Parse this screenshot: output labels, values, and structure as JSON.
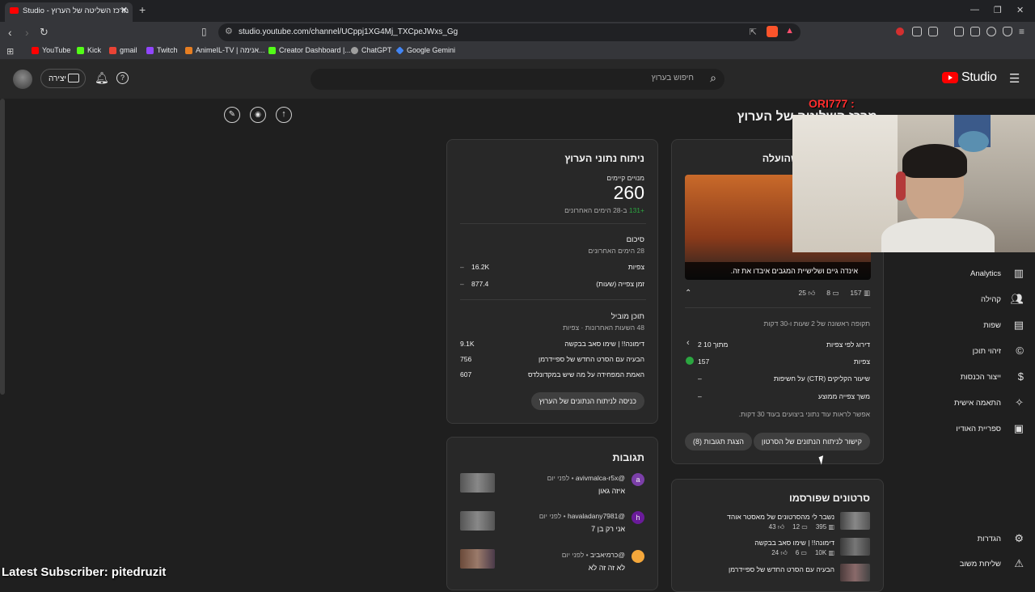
{
  "browser": {
    "tab_title": "מרכז השליטה של הערוץ - Studio",
    "url": "studio.youtube.com/channel/UCppj1XG4Mj_TXCpeJWxs_Gg",
    "bookmarks": [
      "YouTube",
      "Kick",
      "gmail",
      "Twitch",
      "AnimeIL-TV | אנימה...",
      "Creator Dashboard |...",
      "ChatGPT",
      "Google Gemini"
    ],
    "bookmark_colors": [
      "#ff0000",
      "#53fc18",
      "#ea4335",
      "#9146ff",
      "#e67e22",
      "#53fc18",
      "#9e9e9e",
      "#4285f4"
    ]
  },
  "header": {
    "logo_text": "Studio",
    "search_placeholder": "חיפוש בערוץ",
    "create_label": "יצירה"
  },
  "overlay": {
    "streamer_name": "ORI777 :",
    "latest_subscriber": "Latest Subscriber: pitedruzit"
  },
  "page": {
    "title": "מרכז השליטה של הערוץ"
  },
  "latest_video": {
    "heading": "הסרטון האחרון שהועלה",
    "video_title": "אינדה גיים ושלישיית המגבים איבדו את זה.",
    "views": "157",
    "comments": "8",
    "likes": "25",
    "first_period": "תקופה ראשונה של 2 שעות ו-30 דקות",
    "rank_label": "דירוג לפי צפיות",
    "rank_value": "2 מתוך 10",
    "views_label": "צפיות",
    "views_value": "157",
    "ctr_label": "שיעור הקליקים (CTR) על חשיפות",
    "ctr_value": "–",
    "avd_label": "משך צפייה ממוצע",
    "avd_value": "–",
    "note": "אפשר לראות עוד נתוני ביצועים בעוד 30 דקות.",
    "btn_analytics": "קישור לניתוח הנתונים של הסרטון",
    "btn_comments": "הצגת תגובות (8)"
  },
  "channel_analytics": {
    "heading": "ניתוח נתוני הערוץ",
    "subs_label": "מנויים קיימים",
    "subs_value": "260",
    "subs_change_num": "+131",
    "subs_change_text": "ב-28 הימים האחרונים",
    "summary_heading": "סיכום",
    "summary_sub": "28 הימים האחרונים",
    "summary_rows": [
      {
        "label": "צפיות",
        "value": "16.2K",
        "trend": "–"
      },
      {
        "label": "זמן צפייה (שעות)",
        "value": "877.4",
        "trend": "–"
      }
    ],
    "top_heading": "תוכן מוביל",
    "top_sub": "48 השעות האחרונות · צפיות",
    "top_rows": [
      {
        "label": "דימונה!! | שימו סאב בבקשה",
        "value": "9.1K"
      },
      {
        "label": "הבעיה עם הסרט החדש של ספיידרמן",
        "value": "756"
      },
      {
        "label": "האמת המפחידה על מה שיש במקדונלדס",
        "value": "607"
      }
    ],
    "btn": "כניסה לניתוח הנתונים של הערוץ"
  },
  "comments": {
    "heading": "תגובות",
    "items": [
      {
        "user": "@avivmalca-r5x",
        "time": "לפני יום",
        "text": "איזה גאון",
        "avatar_letter": "a",
        "avatar_color": "#7b3fa8"
      },
      {
        "user": "@havaladany7981",
        "time": "לפני יום",
        "text": "אני רק בן 7",
        "avatar_letter": "h",
        "avatar_color": "#6a1b9a"
      },
      {
        "user": "@כרמיאביב",
        "time": "לפני יום",
        "text": "לא זה זה לא",
        "avatar_letter": "",
        "avatar_color": "#f4a73b"
      }
    ]
  },
  "published_shorts": {
    "heading": "סרטונים שפורסמו",
    "items": [
      {
        "title": "נשבר לי מהסרטונים של מאסטר אוהד",
        "views": "395",
        "comments": "12",
        "likes": "43"
      },
      {
        "title": "דימונה!! | שימו סאב בבקשה",
        "views": "10K",
        "comments": "6",
        "likes": "24"
      },
      {
        "title": "הבעיה עם הסרט החדש של ספיידרמן",
        "views": "",
        "comments": "",
        "likes": ""
      }
    ]
  },
  "sidebar": {
    "items": [
      {
        "label": "Analytics",
        "icon": "bar-chart-icon"
      },
      {
        "label": "קהילה",
        "icon": "people-icon"
      },
      {
        "label": "שפות",
        "icon": "subtitles-icon"
      },
      {
        "label": "זיהוי תוכן",
        "icon": "copyright-icon"
      },
      {
        "label": "ייצור הכנסות",
        "icon": "dollar-icon"
      },
      {
        "label": "התאמה אישית",
        "icon": "wand-icon"
      },
      {
        "label": "ספריית האודיו",
        "icon": "audio-library-icon"
      }
    ],
    "bottom": [
      {
        "label": "הגדרות",
        "icon": "gear-icon"
      },
      {
        "label": "שליחת משוב",
        "icon": "feedback-icon"
      }
    ]
  }
}
